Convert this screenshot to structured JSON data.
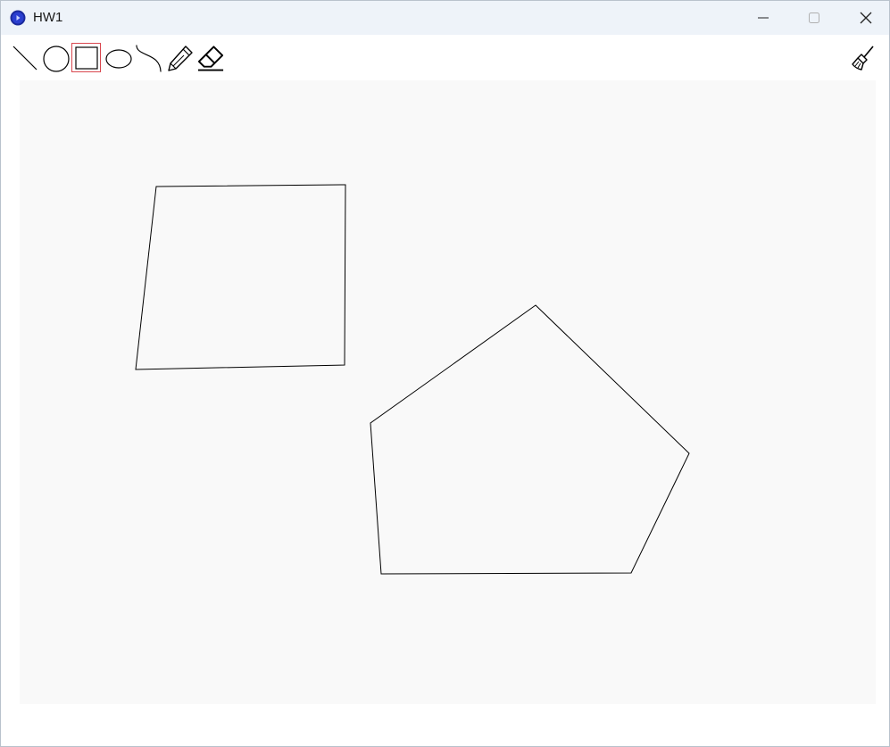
{
  "window": {
    "title": "HW1",
    "app_icon": "app-circle-icon",
    "controls": [
      "minimize-icon",
      "maximize-icon",
      "close-icon"
    ]
  },
  "toolbar": {
    "tools": [
      {
        "name": "line",
        "icon": "line-icon",
        "selected": false
      },
      {
        "name": "circle",
        "icon": "circle-icon",
        "selected": false
      },
      {
        "name": "rectangle",
        "icon": "rectangle-icon",
        "selected": true
      },
      {
        "name": "ellipse",
        "icon": "ellipse-icon",
        "selected": false
      },
      {
        "name": "curve",
        "icon": "curve-icon",
        "selected": false
      },
      {
        "name": "pencil",
        "icon": "pencil-icon",
        "selected": false
      },
      {
        "name": "eraser",
        "icon": "eraser-icon",
        "selected": false
      }
    ],
    "clear_tool": {
      "icon": "broom-icon"
    }
  },
  "canvas": {
    "background": "#f9f9f9",
    "stroke_color": "#000000",
    "shapes": [
      "quadrilateral",
      "pentagon"
    ]
  }
}
